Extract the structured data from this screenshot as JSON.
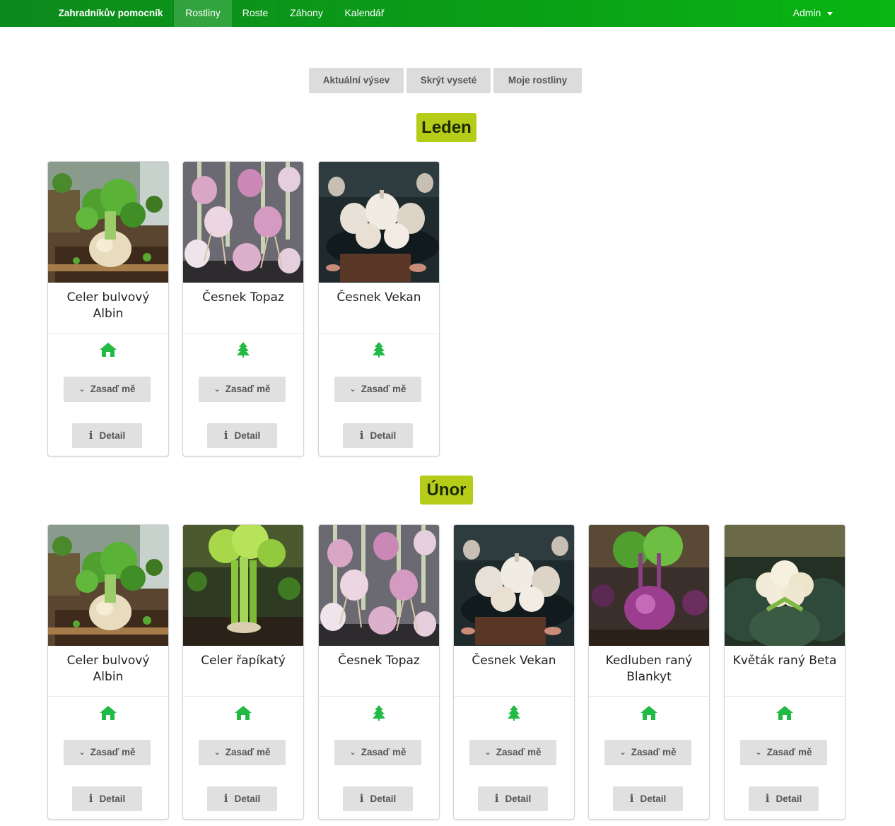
{
  "navbar": {
    "brand": "Zahradníkův pomocník",
    "items": [
      {
        "label": "Rostliny",
        "active": true
      },
      {
        "label": "Roste"
      },
      {
        "label": "Záhony"
      },
      {
        "label": "Kalendář"
      }
    ],
    "user": "Admin"
  },
  "filters": [
    {
      "label": "Aktuální výsev"
    },
    {
      "label": "Skrýt vyseté"
    },
    {
      "label": "Moje rostliny"
    }
  ],
  "colors": {
    "navbar": "#0aa016",
    "month_badge": "#b5cc18",
    "icon_green": "#21ba45",
    "button_bg": "#e0e0e0"
  },
  "months": [
    {
      "name": "Leden",
      "plants": [
        {
          "name": "Celer bulvový Albin",
          "icon": "house-icon",
          "plant_label": "Zasaď mě",
          "detail_label": "Detail"
        },
        {
          "name": "Česnek Topaz",
          "icon": "tree-icon",
          "plant_label": "Zasaď mě",
          "detail_label": "Detail"
        },
        {
          "name": "Česnek Vekan",
          "icon": "tree-icon",
          "plant_label": "Zasaď mě",
          "detail_label": "Detail"
        }
      ]
    },
    {
      "name": "Únor",
      "plants": [
        {
          "name": "Celer bulvový Albin",
          "icon": "house-icon",
          "plant_label": "Zasaď mě",
          "detail_label": "Detail"
        },
        {
          "name": "Celer řapíkatý",
          "icon": "house-icon",
          "plant_label": "Zasaď mě",
          "detail_label": "Detail"
        },
        {
          "name": "Česnek Topaz",
          "icon": "tree-icon",
          "plant_label": "Zasaď mě",
          "detail_label": "Detail"
        },
        {
          "name": "Česnek Vekan",
          "icon": "tree-icon",
          "plant_label": "Zasaď mě",
          "detail_label": "Detail"
        },
        {
          "name": "Kedluben raný Blankyt",
          "icon": "house-icon",
          "plant_label": "Zasaď mě",
          "detail_label": "Detail"
        },
        {
          "name": "Květák raný Beta",
          "icon": "house-icon",
          "plant_label": "Zasaď mě",
          "detail_label": "Detail"
        }
      ]
    }
  ]
}
